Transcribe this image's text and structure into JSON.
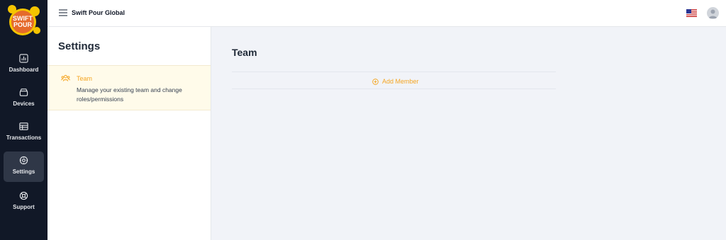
{
  "brand": {
    "logo_text_line1": "SWIFT",
    "logo_text_line2": "POUR"
  },
  "sidebar": {
    "items": [
      {
        "label": "Dashboard",
        "icon": "chart-icon",
        "active": false
      },
      {
        "label": "Devices",
        "icon": "device-icon",
        "active": false
      },
      {
        "label": "Transactions",
        "icon": "table-icon",
        "active": false
      },
      {
        "label": "Settings",
        "icon": "gear-icon",
        "active": true
      },
      {
        "label": "Support",
        "icon": "lifebuoy-icon",
        "active": false
      }
    ]
  },
  "topbar": {
    "title": "Swift Pour Global",
    "language_flag": "us-flag-icon",
    "avatar_icon": "user-avatar-icon"
  },
  "settings": {
    "title": "Settings",
    "items": [
      {
        "title": "Team",
        "description": "Manage your existing team and change roles/permissions",
        "icon": "team-icon"
      }
    ]
  },
  "main": {
    "title": "Team",
    "add_member_label": "Add Member"
  },
  "colors": {
    "accent": "#f5a623",
    "sidebar_bg": "#111827",
    "sidebar_active": "#2f3747",
    "content_bg": "#f1f3f8",
    "selected_item_bg": "#fffbea"
  }
}
